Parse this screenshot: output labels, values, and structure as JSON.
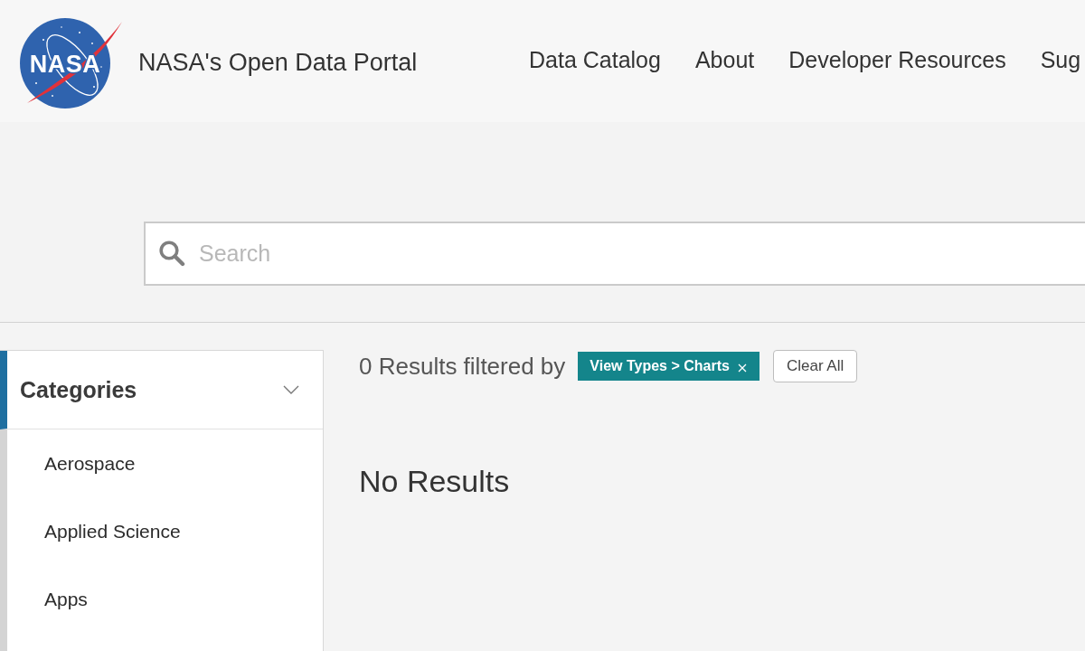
{
  "header": {
    "logo_text": "NASA",
    "title": "NASA's Open Data Portal",
    "nav": [
      {
        "label": "Data Catalog"
      },
      {
        "label": "About"
      },
      {
        "label": "Developer Resources"
      },
      {
        "label": "Sug"
      }
    ]
  },
  "search": {
    "placeholder": "Search"
  },
  "sidebar": {
    "sections": [
      {
        "title": "Categories",
        "expanded": true,
        "items": [
          "Aerospace",
          "Applied Science",
          "Apps"
        ]
      }
    ]
  },
  "results": {
    "summary": "0 Results filtered by",
    "filters": [
      {
        "label": "View Types > Charts"
      }
    ],
    "clear_button": "Clear All",
    "empty_message": "No Results"
  }
}
